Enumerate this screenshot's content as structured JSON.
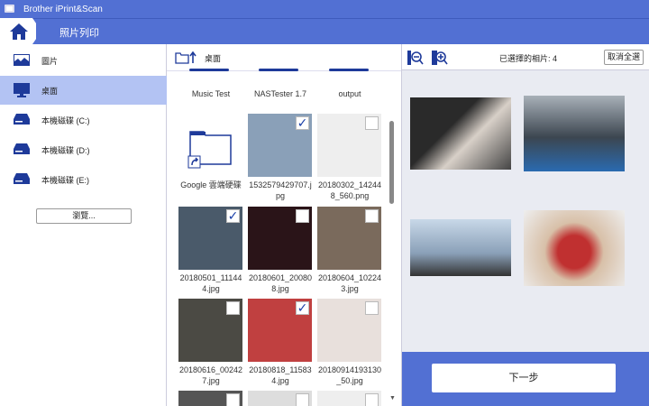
{
  "app_title": "Brother iPrint&Scan",
  "header": {
    "title": "照片列印"
  },
  "sidebar": {
    "items": [
      {
        "label": "圖片",
        "icon": "picture-icon"
      },
      {
        "label": "桌面",
        "icon": "monitor-icon",
        "selected": true
      },
      {
        "label": "本機磁碟 (C:)",
        "icon": "drive-icon"
      },
      {
        "label": "本機磁碟 (D:)",
        "icon": "drive-icon"
      },
      {
        "label": "本機磁碟 (E:)",
        "icon": "drive-icon"
      }
    ],
    "browse_label": "瀏覽..."
  },
  "browser": {
    "path": "桌面",
    "folders_top": [
      "Music Test",
      "NASTester 1.7",
      "output"
    ],
    "items": [
      {
        "name": "Google 雲端硬碟",
        "type": "folder"
      },
      {
        "name": "1532579429707.jpg",
        "checked": true,
        "color": "#8aa0b8"
      },
      {
        "name": "20180302_142448_560.png",
        "checked": false,
        "color": "#eeeeee"
      },
      {
        "name": "20180501_111444.jpg",
        "checked": true,
        "color": "#4a5a6a"
      },
      {
        "name": "20180601_200808.jpg",
        "checked": false,
        "color": "#2a1418"
      },
      {
        "name": "20180604_102243.jpg",
        "checked": false,
        "color": "#7a6a5c"
      },
      {
        "name": "20180616_002427.jpg",
        "checked": false,
        "color": "#4b4a44"
      },
      {
        "name": "20180818_115834.jpg",
        "checked": true,
        "color": "#c04040"
      },
      {
        "name": "2018091419313050.jpg",
        "checked": false,
        "color": "#e8e0dc"
      }
    ],
    "labels": [
      "Google 雲端硬碟",
      "1532579429707.j\npg",
      "20180302_14244\n8_560.png",
      "20180501_11144\n4.jpg",
      "20180601_20080\n8.jpg",
      "20180604_10224\n3.jpg",
      "20180616_00242\n7.jpg",
      "20180818_11583\n4.jpg",
      "20180914193130\n_50.jpg"
    ]
  },
  "selection": {
    "label": "已選擇的相片: 4",
    "cancel_all": "取消全選",
    "next": "下一步"
  },
  "colors": {
    "brand": "#5270d3",
    "selected": "#b3c3f3"
  }
}
